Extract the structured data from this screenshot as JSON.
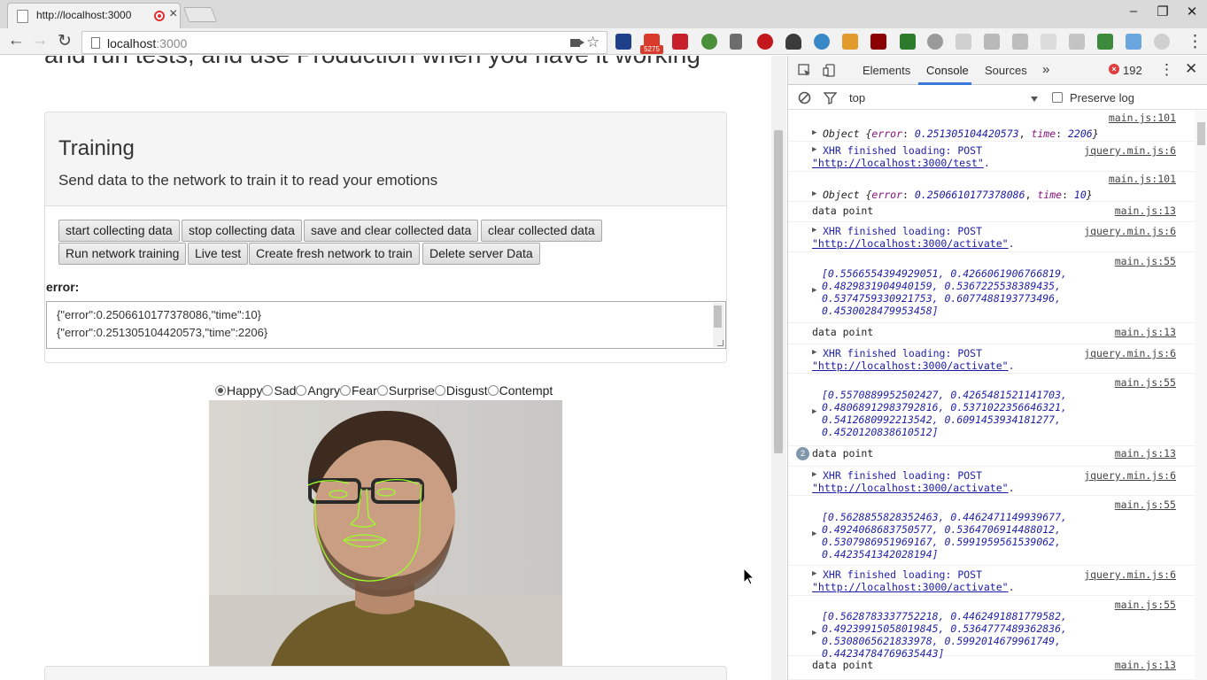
{
  "browser": {
    "tab_title": "http://localhost:3000",
    "tab_close": "×",
    "url_host": "localhost",
    "url_rest": ":3000",
    "window_min": "–",
    "window_restore": "❐",
    "window_close": "✕",
    "ext_badge": "5275"
  },
  "page": {
    "headline": "and run tests, and use Production when you have it working",
    "panel_title": "Training",
    "panel_subtitle": "Send data to the network to train it to read your emotions",
    "buttons_row1": [
      "start collecting data",
      "stop collecting data",
      "save and clear collected data",
      "clear collected data"
    ],
    "buttons_row2": [
      "Run network training",
      "Live test",
      "Create fresh network to train",
      "Delete server Data"
    ],
    "error_label": "error:",
    "error_lines": [
      "{\"error\":0.2506610177378086,\"time\":10}",
      "{\"error\":0.251305104420573,\"time\":2206}"
    ],
    "emotions": [
      "Happy",
      "Sad",
      "Angry",
      "Fear",
      "Surprise",
      "Disgust",
      "Contempt"
    ],
    "selected_emotion": "Happy"
  },
  "devtools": {
    "tabs": [
      "Elements",
      "Console",
      "Sources"
    ],
    "active_tab": "Console",
    "more_tabs": "»",
    "error_count": "192",
    "context": "top",
    "preserve_log": "Preserve log",
    "messages": [
      {
        "src": "main.js:101",
        "lines": [
          "Object {error: 0.251305104420573, time: 2206}"
        ]
      },
      {
        "src": "jquery.min.js:6",
        "lines": [
          "XHR finished loading: POST",
          "\"http://localhost:3000/test\"."
        ]
      },
      {
        "src": "main.js:101",
        "lines": [
          "Object {error: 0.2506610177378086, time: 10}"
        ]
      },
      {
        "src": "main.js:13",
        "lines": [
          "data point"
        ]
      },
      {
        "src": "jquery.min.js:6",
        "lines": [
          "XHR finished loading: POST",
          "\"http://localhost:3000/activate\"."
        ]
      },
      {
        "src": "main.js:55",
        "lines": [
          "[0.5566554394929051, 0.4266061906766819,",
          "0.4829831904940159, 0.5367225538389435,",
          "0.5374759330921753, 0.6077488193773496,",
          "0.4530028479953458]"
        ]
      },
      {
        "src": "main.js:13",
        "lines": [
          "data point"
        ]
      },
      {
        "src": "jquery.min.js:6",
        "lines": [
          "XHR finished loading: POST",
          "\"http://localhost:3000/activate\"."
        ]
      },
      {
        "src": "main.js:55",
        "lines": [
          "[0.5570889952502427, 0.4265481521141703,",
          "0.48068912983792816, 0.5371022356646321,",
          "0.5412680992213542, 0.6091453934181277,",
          "0.4520120838610512]"
        ]
      },
      {
        "src": "main.js:13",
        "count": "2",
        "lines": [
          "data point"
        ]
      },
      {
        "src": "jquery.min.js:6",
        "lines": [
          "XHR finished loading: POST",
          "\"http://localhost:3000/activate\"."
        ]
      },
      {
        "src": "main.js:55",
        "lines": [
          "[0.5628855828352463, 0.4462471149939677,",
          "0.4924068683750577, 0.5364706914488012,",
          "0.5307986951969167, 0.5991959561539062,",
          "0.4423541342028194]"
        ]
      },
      {
        "src": "jquery.min.js:6",
        "lines": [
          "XHR finished loading: POST",
          "\"http://localhost:3000/activate\"."
        ]
      },
      {
        "src": "main.js:55",
        "lines": [
          "[0.5628783337752218, 0.4462491881779582,",
          "0.49239915058019845, 0.5364777489362836,",
          "0.5308065621833978, 0.5992014679961749,",
          "0.44234784769635443]"
        ]
      },
      {
        "src": "main.js:13",
        "lines": [
          "data point"
        ]
      }
    ]
  }
}
